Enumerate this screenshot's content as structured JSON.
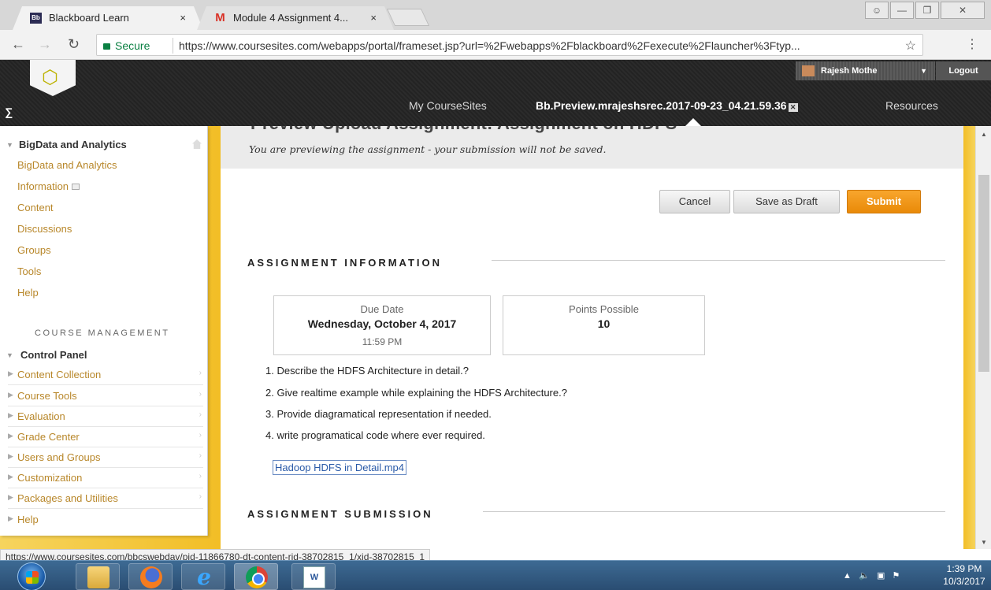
{
  "browser": {
    "tabs": [
      {
        "favicon": "Bb",
        "title": "Blackboard Learn",
        "close": "×"
      },
      {
        "favicon": "M",
        "title": "Module 4 Assignment 4...",
        "close": "×"
      }
    ],
    "window_controls": [
      "minimize",
      "maximize",
      "close"
    ],
    "secure_label": "Secure",
    "url": "https://www.coursesites.com/webapps/portal/frameset.jsp?url=%2Fwebapps%2Fblackboard%2Fexecute%2Flauncher%3Ftyp...",
    "status_url": "https://www.coursesites.com/bbcswebdav/pid-11866780-dt-content-rid-38702815_1/xid-38702815_1"
  },
  "header": {
    "user_name": "Rajesh Mothe",
    "logout_label": "Logout",
    "nav": {
      "my_coursesites": "My CourseSites",
      "course": "Bb.Preview.mrajeshsrec.2017-09-23_04.21.59.36",
      "resources": "Resources"
    }
  },
  "sidebar": {
    "course_title": "BigData and Analytics",
    "links": [
      "BigData and Analytics",
      "Information",
      "Content",
      "Discussions",
      "Groups",
      "Tools",
      "Help"
    ],
    "management_heading": "COURSE MANAGEMENT",
    "control_panel": "Control Panel",
    "control_items": [
      "Content Collection",
      "Course Tools",
      "Evaluation",
      "Grade Center",
      "Users and Groups",
      "Customization",
      "Packages and Utilities",
      "Help"
    ]
  },
  "main": {
    "cut_title": "Preview Upload Assignment: Assignment on HDFS",
    "preview_message": "You are previewing the assignment - your submission will not be saved.",
    "buttons": {
      "cancel": "Cancel",
      "save_draft": "Save as Draft",
      "submit": "Submit"
    },
    "assignment_info_heading": "ASSIGNMENT INFORMATION",
    "due_label": "Due Date",
    "due_date": "Wednesday, October 4, 2017",
    "due_time": "11:59 PM",
    "points_label": "Points Possible",
    "points_value": "10",
    "questions": [
      "1. Describe the HDFS Architecture in detail.?",
      "2. Give realtime example while explaining the HDFS Architecture.?",
      "3. Provide diagramatical representation if needed.",
      "4. write programatical code where ever required."
    ],
    "attachment": "Hadoop HDFS in Detail.mp4",
    "submission_heading": "ASSIGNMENT SUBMISSION"
  },
  "taskbar": {
    "apps": [
      "folder-icon",
      "firefox-icon",
      "ie-icon",
      "chrome-icon",
      "word-icon"
    ],
    "time": "1:39 PM",
    "date": "10/3/2017"
  }
}
